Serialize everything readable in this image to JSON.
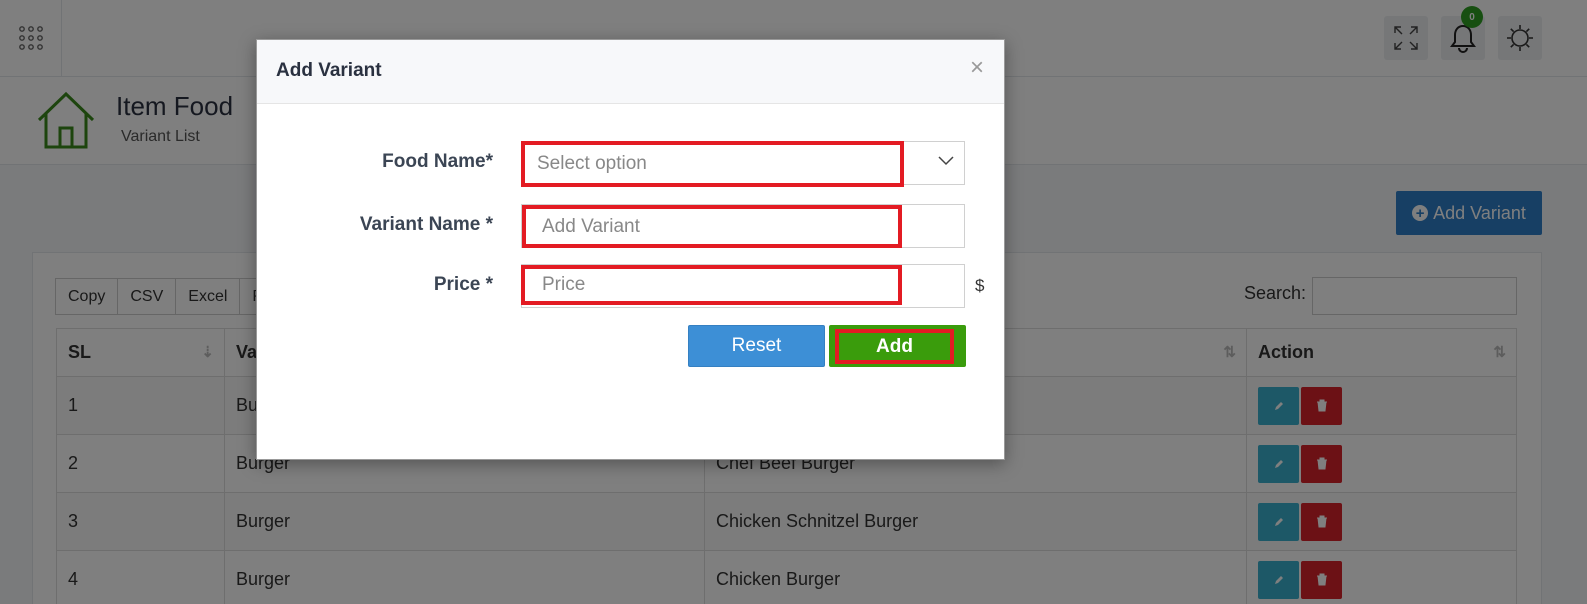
{
  "topbar": {
    "apps_icon": "grid-dots-icon",
    "expand_icon": "fullscreen-icon",
    "notification_icon": "bell-icon",
    "notification_count": "0",
    "settings_icon": "gear-icon"
  },
  "page_header": {
    "icon": "home-icon",
    "title": "Item Food",
    "subtitle": "Variant List"
  },
  "main": {
    "add_variant_label": "Add Variant",
    "export_buttons": [
      "Copy",
      "CSV",
      "Excel",
      "P"
    ],
    "search_label": "Search:",
    "table": {
      "columns": [
        "SL",
        "Va",
        "",
        "Action"
      ],
      "rows": [
        {
          "sl": "1",
          "food": "Bu",
          "variant": ""
        },
        {
          "sl": "2",
          "food": "Burger",
          "variant": "Chef Beef Burger"
        },
        {
          "sl": "3",
          "food": "Burger",
          "variant": "Chicken Schnitzel Burger"
        },
        {
          "sl": "4",
          "food": "Burger",
          "variant": "Chicken Burger"
        }
      ]
    }
  },
  "modal": {
    "title": "Add Variant",
    "close": "×",
    "food_name_label": "Food Name*",
    "food_name_placeholder": "Select option",
    "variant_name_label": "Variant Name *",
    "variant_name_placeholder": "Add Variant",
    "price_label": "Price *",
    "price_placeholder": "Price",
    "currency": "$",
    "reset_label": "Reset",
    "add_label": "Add"
  },
  "colors": {
    "primary_blue": "#2f7fc8",
    "add_green": "#3a9c0c",
    "highlight_red": "#e31b23",
    "edit_cyan": "#3ab0cf",
    "delete_red": "#d9232a"
  }
}
